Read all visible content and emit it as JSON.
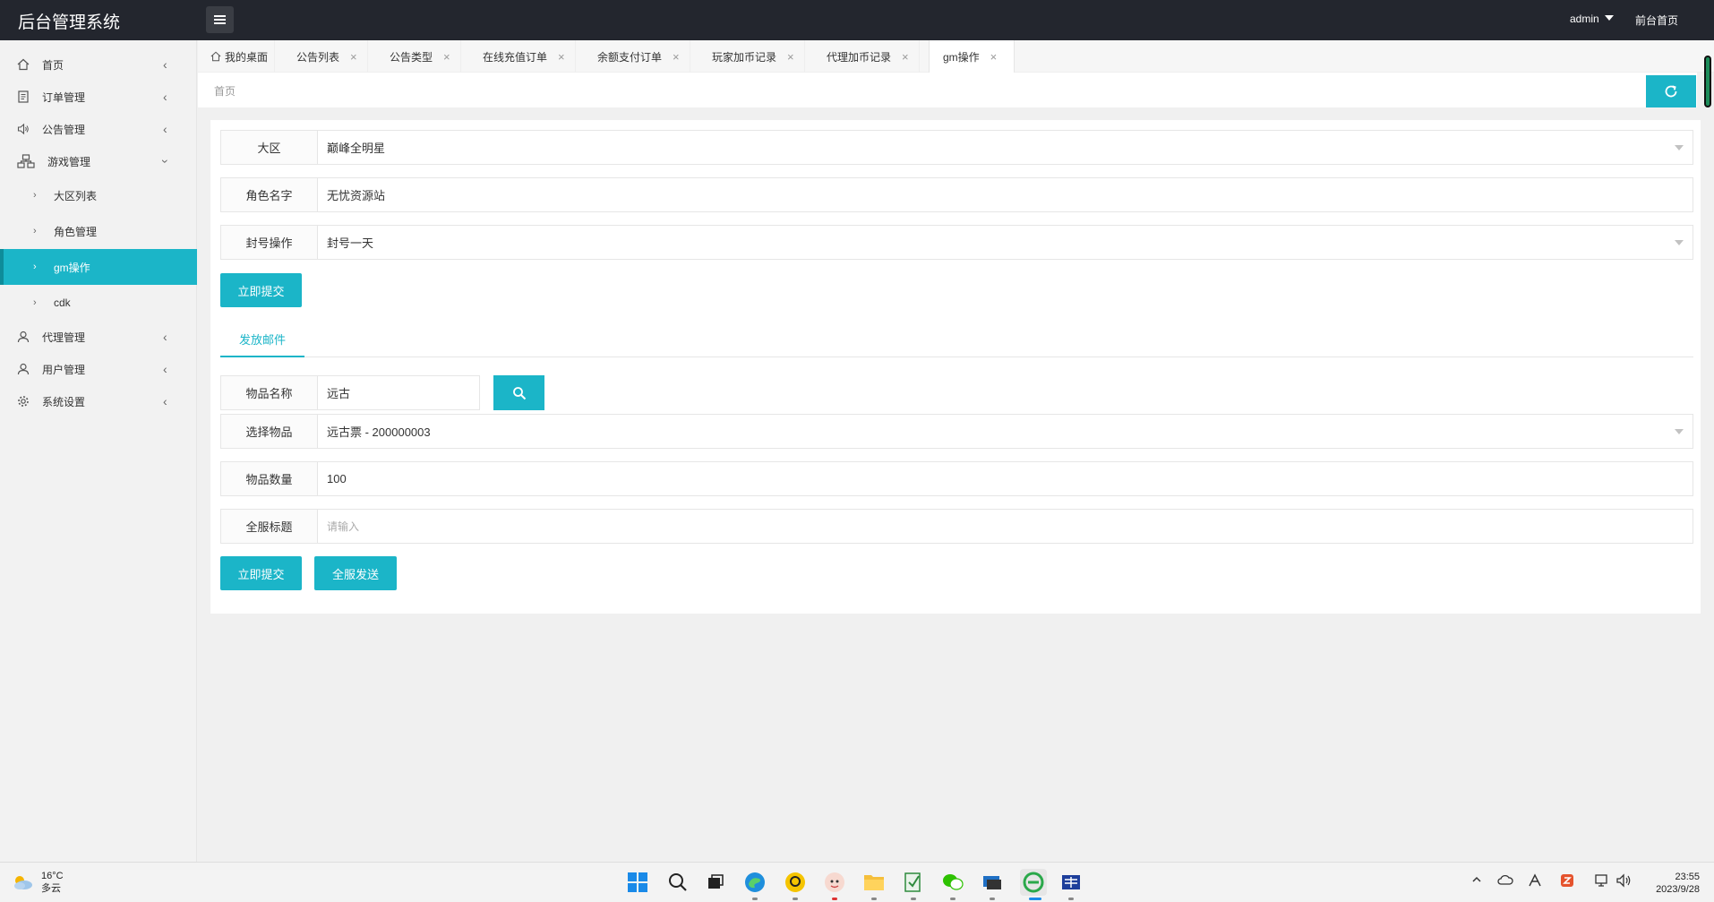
{
  "header": {
    "title": "后台管理系统",
    "user": "admin",
    "front_page": "前台首页"
  },
  "sidebar": {
    "items": [
      {
        "label": "首页",
        "icon": "home-icon"
      },
      {
        "label": "订单管理",
        "icon": "document-icon"
      },
      {
        "label": "公告管理",
        "icon": "speaker-icon"
      },
      {
        "label": "游戏管理",
        "icon": "sitemap-icon"
      },
      {
        "label": "代理管理",
        "icon": "user-icon"
      },
      {
        "label": "用户管理",
        "icon": "user-icon"
      },
      {
        "label": "系统设置",
        "icon": "gear-icon"
      }
    ],
    "sub_items": [
      {
        "label": "大区列表"
      },
      {
        "label": "角色管理"
      },
      {
        "label": "gm操作"
      },
      {
        "label": "cdk"
      }
    ]
  },
  "tabs": [
    {
      "label": "我的桌面"
    },
    {
      "label": "公告列表"
    },
    {
      "label": "公告类型"
    },
    {
      "label": "在线充值订单"
    },
    {
      "label": "余额支付订单"
    },
    {
      "label": "玩家加币记录"
    },
    {
      "label": "代理加币记录"
    },
    {
      "label": "gm操作"
    }
  ],
  "breadcrumb": "首页",
  "form1": {
    "region_label": "大区",
    "region_value": "巅峰全明星",
    "role_label": "角色名字",
    "role_value": "无忧资源站",
    "ban_label": "封号操作",
    "ban_value": "封号一天",
    "submit": "立即提交"
  },
  "mail_tab": "发放邮件",
  "form2": {
    "item_name_label": "物品名称",
    "item_name_value": "远古",
    "select_item_label": "选择物品",
    "select_item_value": "远古票 - 200000003",
    "quantity_label": "物品数量",
    "quantity_value": "100",
    "server_title_label": "全服标题",
    "server_title_placeholder": "请输入",
    "submit": "立即提交",
    "send_all": "全服发送"
  },
  "taskbar": {
    "temperature": "16°C",
    "weather": "多云",
    "time": "23:55",
    "date": "2023/9/28"
  },
  "colors": {
    "accent": "#1bb5c8",
    "header_bg": "#23262e"
  }
}
